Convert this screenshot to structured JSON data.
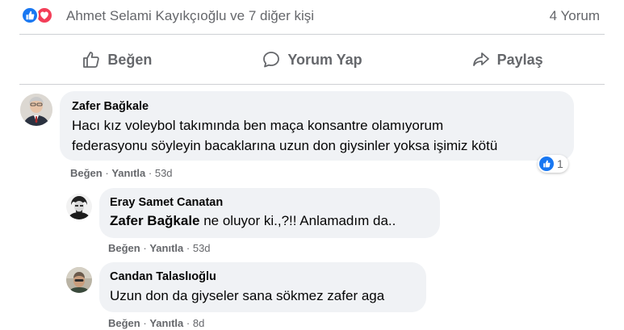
{
  "summary": {
    "reactions": [
      "like-icon",
      "love-icon"
    ],
    "reactors_text": "Ahmet Selami Kayıkçıoğlu ve 7 diğer kişi",
    "comment_count": "4 Yorum"
  },
  "actions": {
    "like": "Beğen",
    "comment": "Yorum Yap",
    "share": "Paylaş"
  },
  "comments": [
    {
      "author": "Zafer Bağkale",
      "lines": [
        "Hacı kız voleybol takımında ben maça konsantre olamıyorum",
        "federasyonu söyleyin bacaklarına uzun don giysinler yoksa işimiz kötü"
      ],
      "like": "Beğen",
      "reply": "Yanıtla",
      "time": "53d",
      "reaction_count": "1"
    },
    {
      "author": "Eray Samet Canatan",
      "mention": "Zafer Bağkale",
      "text": " ne oluyor ki.,?!! Anlamadım da..",
      "like": "Beğen",
      "reply": "Yanıtla",
      "time": "53d"
    },
    {
      "author": "Candan Talaslıoğlu",
      "text": "Uzun don da giyseler sana sökmez zafer aga",
      "like": "Beğen",
      "reply": "Yanıtla",
      "time": "8d"
    }
  ],
  "separator": "·",
  "colors": {
    "like_blue": "#1877f2",
    "love_red": "#f33e58",
    "bubble": "#f0f2f5",
    "secondary_text": "#65676b"
  }
}
